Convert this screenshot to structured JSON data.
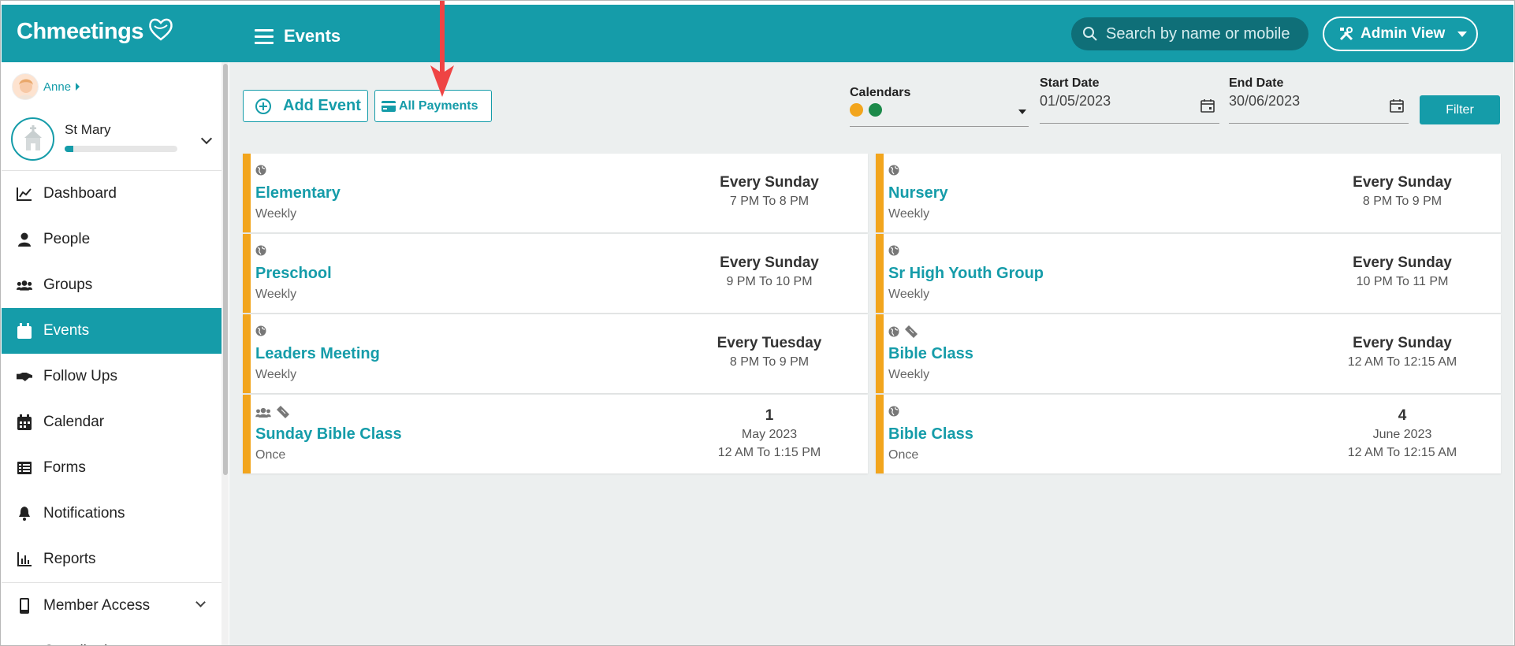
{
  "header": {
    "logo_text": "Chmeetings",
    "page_title": "Events",
    "search_placeholder": "Search by name or mobile",
    "admin_view_label": "Admin View"
  },
  "sidebar": {
    "user_name": "Anne",
    "church_name": "St Mary",
    "church_progress": 0.08,
    "items": [
      {
        "label": "Dashboard",
        "icon": "chart-line-icon"
      },
      {
        "label": "People",
        "icon": "person-icon"
      },
      {
        "label": "Groups",
        "icon": "users-icon"
      },
      {
        "label": "Events",
        "icon": "calendar-icon",
        "active": true
      },
      {
        "label": "Follow Ups",
        "icon": "handshake-icon"
      },
      {
        "label": "Calendar",
        "icon": "calendar-grid-icon"
      },
      {
        "label": "Forms",
        "icon": "list-icon"
      },
      {
        "label": "Notifications",
        "icon": "bell-icon"
      },
      {
        "label": "Reports",
        "icon": "bar-chart-icon"
      },
      {
        "label": "Member Access",
        "icon": "mobile-icon"
      },
      {
        "label": "Contributions",
        "icon": "money-icon"
      }
    ]
  },
  "toolbar": {
    "add_event_label": "Add Event",
    "all_payments_label": "All Payments"
  },
  "filters": {
    "calendars_label": "Calendars",
    "calendar_colors": [
      "#f2a51d",
      "#1c8a4a"
    ],
    "start_date_label": "Start Date",
    "start_date_value": "01/05/2023",
    "end_date_label": "End Date",
    "end_date_value": "30/06/2023",
    "filter_label": "Filter"
  },
  "colors": {
    "accent": "#159ca9",
    "card_stripe": "#f2a51d",
    "arrow": "#ef4444"
  },
  "events_left": [
    {
      "title": "Elementary",
      "frequency": "Weekly",
      "when_main": "Every Sunday",
      "when_sub": "7 PM To 8 PM",
      "icons": [
        "globe-icon"
      ]
    },
    {
      "title": "Preschool",
      "frequency": "Weekly",
      "when_main": "Every Sunday",
      "when_sub": "9 PM To 10 PM",
      "icons": [
        "globe-icon"
      ]
    },
    {
      "title": "Leaders Meeting",
      "frequency": "Weekly",
      "when_main": "Every Tuesday",
      "when_sub": "8 PM To 9 PM",
      "icons": [
        "globe-icon"
      ]
    },
    {
      "title": "Sunday Bible Class",
      "frequency": "Once",
      "when_main": "1",
      "when_sub": "May 2023",
      "when_sub2": "12 AM To 1:15 PM",
      "icons": [
        "users-icon",
        "ticket-icon"
      ]
    }
  ],
  "events_right": [
    {
      "title": "Nursery",
      "frequency": "Weekly",
      "when_main": "Every Sunday",
      "when_sub": "8 PM To 9 PM",
      "icons": [
        "globe-icon"
      ]
    },
    {
      "title": "Sr High Youth Group",
      "frequency": "Weekly",
      "when_main": "Every Sunday",
      "when_sub": "10 PM To 11 PM",
      "icons": [
        "globe-icon"
      ]
    },
    {
      "title": "Bible Class",
      "frequency": "Weekly",
      "when_main": "Every Sunday",
      "when_sub": "12 AM To 12:15 AM",
      "icons": [
        "globe-icon",
        "ticket-icon"
      ]
    },
    {
      "title": "Bible Class",
      "frequency": "Once",
      "when_main": "4",
      "when_sub": "June 2023",
      "when_sub2": "12 AM To 12:15 AM",
      "icons": [
        "globe-icon"
      ]
    }
  ]
}
